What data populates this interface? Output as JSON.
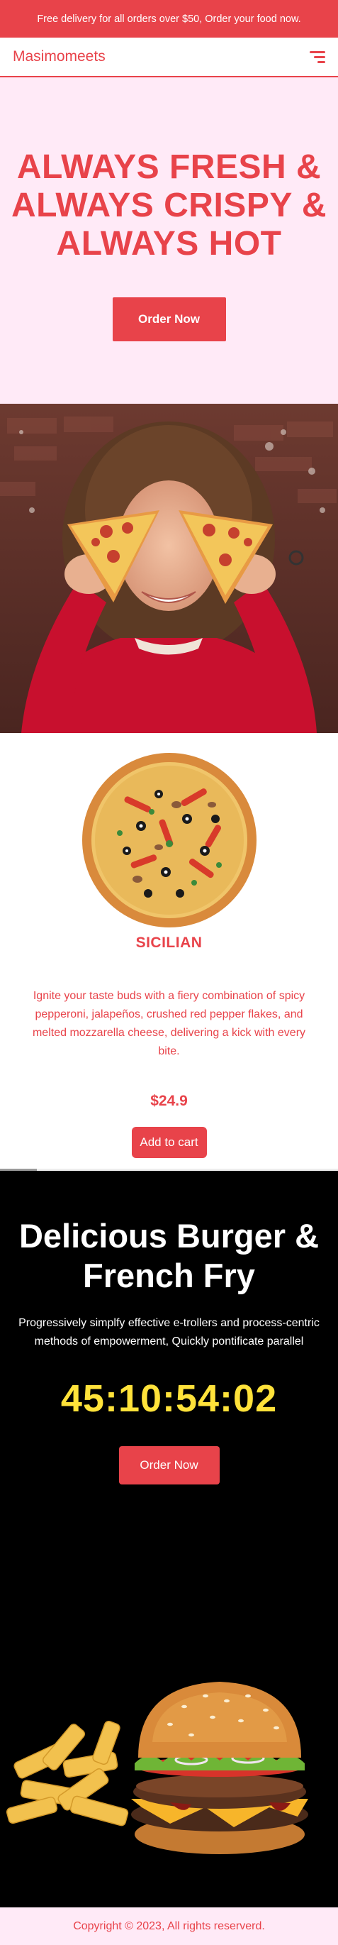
{
  "announcement": "Free delivery for all orders over $50, Order your food now.",
  "header": {
    "brand": "Masimomeets",
    "menu_icon": "hamburger-menu-icon"
  },
  "hero": {
    "title": "ALWAYS FRESH & ALWAYS CRISPY & ALWAYS HOT",
    "cta": "Order Now"
  },
  "photo": {
    "subject": "person-holding-pizza-slices-photo"
  },
  "product": {
    "name": "SICILIAN",
    "description": "Ignite your taste buds with a fiery combination of spicy pepperoni, jalapeños, crushed red pepper flakes, and melted mozzarella cheese, delivering a kick with every bite.",
    "price": "$24.9",
    "cta": "Add to cart"
  },
  "promo": {
    "title": "Delicious Burger & French Fry",
    "description": "Progressively simplfy effective e-trollers and process-centric methods of empowerment, Quickly pontificate parallel",
    "countdown": "45:10:54:02",
    "cta": "Order Now"
  },
  "footer": {
    "copyright": "Copyright © 2023, All rights reserverd."
  },
  "colors": {
    "accent": "#e8434a",
    "hero_bg": "#ffeaf7",
    "promo_bg": "#000000",
    "countdown": "#ffe23a"
  }
}
